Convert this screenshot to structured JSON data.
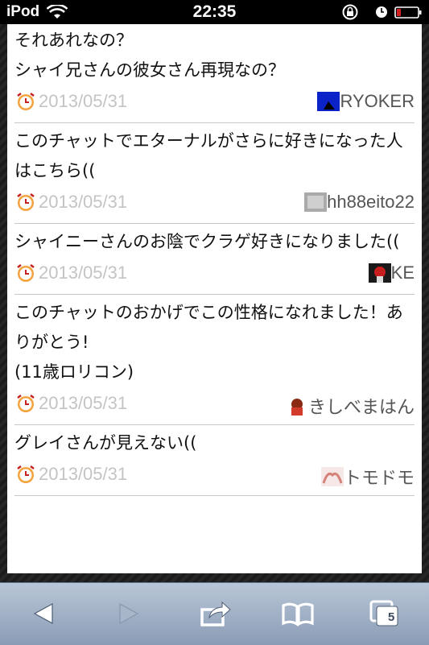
{
  "status_bar": {
    "carrier": "iPod",
    "time": "22:35"
  },
  "entries": [
    {
      "text": "それあれなの？\nシャイ兄さんの彼女さん再現なの？",
      "date": "2013/05/31",
      "user": "RYOKER"
    },
    {
      "text": "このチャットでエターナルがさらに好きになった人はこちら((",
      "date": "2013/05/31",
      "user": "hh88eito22"
    },
    {
      "text": "シャイニーさんのお陰でクラゲ好きになりました((",
      "date": "2013/05/31",
      "user": "KE"
    },
    {
      "text": "このチャットのおかげでこの性格になれました！ありがとう!\n(11歳ロリコン)",
      "date": "2013/05/31",
      "user": "きしべまはん"
    },
    {
      "text": "グレイさんが見えない((",
      "date": "2013/05/31",
      "user": "トモドモ"
    }
  ],
  "toolbar": {
    "tabs_count": "5"
  },
  "colors": {
    "toolbar_top": "#b9c6d7",
    "toolbar_bottom": "#8a9cb5",
    "date_gray": "#c4c4c4"
  }
}
